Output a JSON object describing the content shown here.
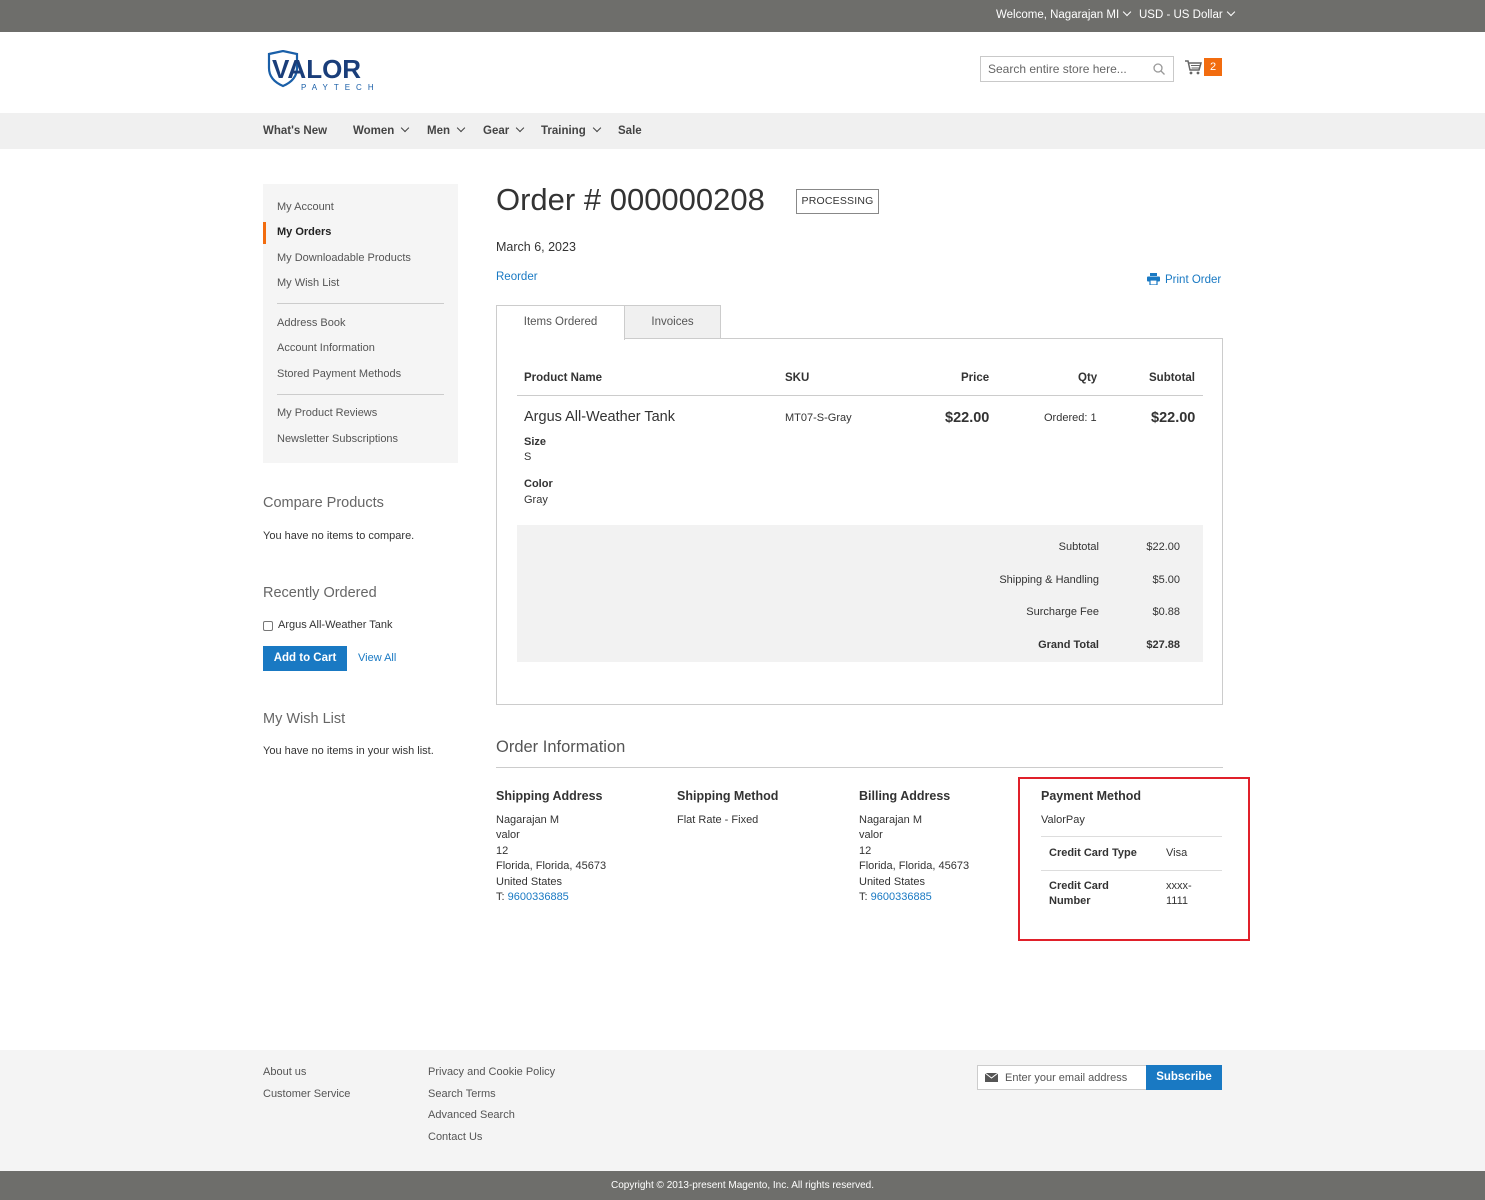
{
  "topbar": {
    "welcome": "Welcome, Nagarajan MI",
    "currency": "USD - US Dollar"
  },
  "header": {
    "logo_text": "VALOR",
    "logo_sub": "PAYTECH",
    "search_placeholder": "Search entire store here...",
    "cart_count": "2"
  },
  "nav": [
    {
      "label": "What's New",
      "dropdown": false
    },
    {
      "label": "Women",
      "dropdown": true
    },
    {
      "label": "Men",
      "dropdown": true
    },
    {
      "label": "Gear",
      "dropdown": true
    },
    {
      "label": "Training",
      "dropdown": true
    },
    {
      "label": "Sale",
      "dropdown": false
    }
  ],
  "sidebar": {
    "items": [
      "My Account",
      "My Orders",
      "My Downloadable Products",
      "My Wish List",
      "Address Book",
      "Account Information",
      "Stored Payment Methods",
      "My Product Reviews",
      "Newsletter Subscriptions"
    ],
    "active": "My Orders"
  },
  "compare": {
    "title": "Compare Products",
    "text": "You have no items to compare."
  },
  "recently_ordered": {
    "title": "Recently Ordered",
    "item": "Argus All-Weather Tank",
    "add_to_cart": "Add to Cart",
    "view_all": "View All"
  },
  "wishlist": {
    "title": "My Wish List",
    "text": "You have no items in your wish list."
  },
  "order": {
    "title": "Order # 000000208",
    "status": "PROCESSING",
    "date": "March 6, 2023",
    "reorder": "Reorder",
    "print": "Print Order",
    "tabs": [
      "Items Ordered",
      "Invoices"
    ],
    "columns": {
      "product": "Product Name",
      "sku": "SKU",
      "price": "Price",
      "qty": "Qty",
      "subtotal": "Subtotal"
    },
    "item": {
      "name": "Argus All-Weather Tank",
      "size_label": "Size",
      "size": "S",
      "color_label": "Color",
      "color": "Gray",
      "sku": "MT07-S-Gray",
      "price": "$22.00",
      "qty": "Ordered: 1",
      "subtotal": "$22.00"
    },
    "totals": [
      {
        "label": "Subtotal",
        "value": "$22.00"
      },
      {
        "label": "Shipping & Handling",
        "value": "$5.00"
      },
      {
        "label": "Surcharge Fee",
        "value": "$0.88"
      },
      {
        "label": "Grand Total",
        "value": "$27.88"
      }
    ]
  },
  "order_info": {
    "title": "Order Information",
    "shipping_address": {
      "title": "Shipping Address",
      "lines": [
        "Nagarajan M",
        "valor",
        "12",
        "Florida, Florida, 45673",
        "United States"
      ],
      "phone_prefix": "T: ",
      "phone": "9600336885"
    },
    "shipping_method": {
      "title": "Shipping Method",
      "value": "Flat Rate - Fixed"
    },
    "billing_address": {
      "title": "Billing Address",
      "lines": [
        "Nagarajan M",
        "valor",
        "12",
        "Florida, Florida, 45673",
        "United States"
      ],
      "phone_prefix": "T: ",
      "phone": "9600336885"
    },
    "payment_method": {
      "title": "Payment Method",
      "name": "ValorPay",
      "card_type_label": "Credit Card Type",
      "card_type": "Visa",
      "card_number_label_1": "Credit Card",
      "card_number_label_2": "Number",
      "card_number_1": "xxxx-",
      "card_number_2": "1111"
    }
  },
  "footer": {
    "col1": [
      "About us",
      "Customer Service"
    ],
    "col2": [
      "Privacy and Cookie Policy",
      "Search Terms",
      "Advanced Search",
      "Contact Us"
    ],
    "newsletter_placeholder": "Enter your email address",
    "subscribe": "Subscribe",
    "copyright": "Copyright © 2013-present Magento, Inc. All rights reserved."
  },
  "colors": {
    "accent": "#1979c3",
    "orange": "#f26c0f",
    "highlight": "#e0202a",
    "topbar": "#6e6e6b"
  }
}
